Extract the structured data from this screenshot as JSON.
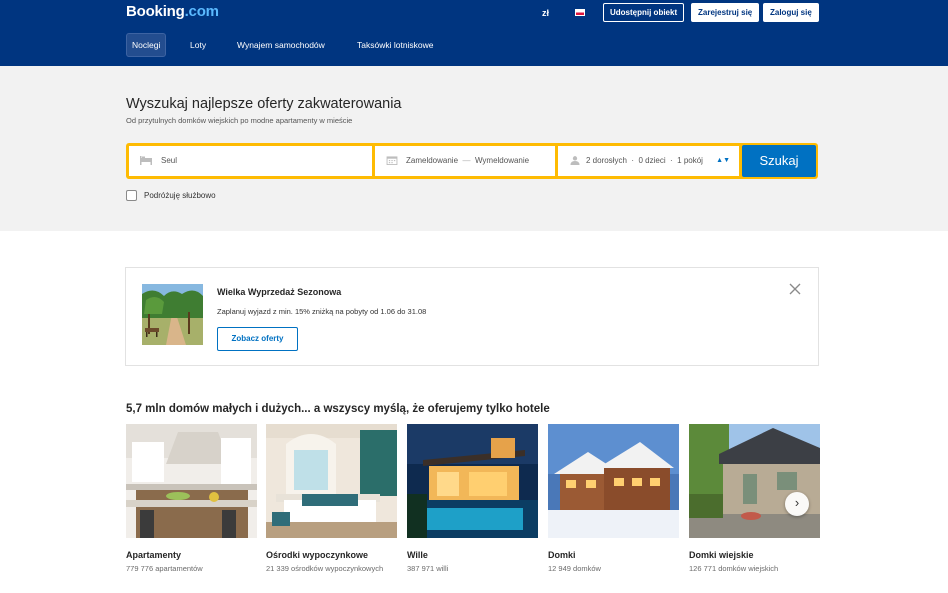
{
  "header": {
    "logo_main": "Booking",
    "logo_suffix": ".com",
    "currency": "zł",
    "list_property": "Udostępnij obiekt",
    "register": "Zarejestruj się",
    "login": "Zaloguj się",
    "nav": [
      {
        "label": "Noclegi",
        "active": true
      },
      {
        "label": "Loty",
        "active": false
      },
      {
        "label": "Wynajem samochodów",
        "active": false
      },
      {
        "label": "Taksówki lotniskowe",
        "active": false
      }
    ]
  },
  "search": {
    "title": "Wyszukaj najlepsze oferty zakwaterowania",
    "subtitle": "Od przytulnych domków wiejskich po modne apartamenty w mieście",
    "destination_value": "Seul",
    "checkin": "Zameldowanie",
    "date_separator": "—",
    "checkout": "Wymeldowanie",
    "guests": "2 dorosłych  ·  0 dzieci  ·  1 pokój",
    "button": "Szukaj",
    "business_travel": "Podróżuję służbowo"
  },
  "promo": {
    "title": "Wielka Wyprzedaż Sezonowa",
    "description": "Zaplanuj wyjazd z min. 15% zniżką na pobyty od 1.06 do 31.08",
    "button": "Zobacz oferty"
  },
  "categories": {
    "title": "5,7 mln domów małych i dużych... a wszyscy myślą, że oferujemy tylko hotele",
    "items": [
      {
        "name": "Apartamenty",
        "count": "779 776 apartamentów"
      },
      {
        "name": "Ośrodki wypoczynkowe",
        "count": "21 339 ośrodków wypoczynkowych"
      },
      {
        "name": "Wille",
        "count": "387 971 willi"
      },
      {
        "name": "Domki",
        "count": "12 949 domków"
      },
      {
        "name": "Domki wiejskie",
        "count": "126 771 domków wiejskich"
      }
    ]
  },
  "colors": {
    "brand_blue": "#003580",
    "accent_blue": "#0071c2",
    "search_yellow": "#febb02"
  }
}
